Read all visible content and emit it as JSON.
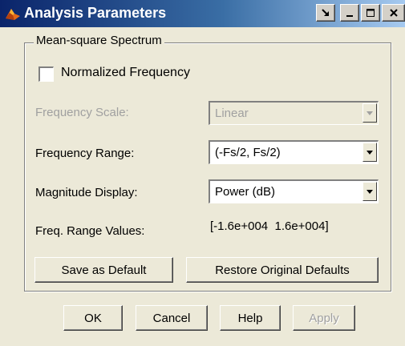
{
  "window": {
    "title": "Analysis Parameters",
    "controls": {
      "dock": "dock",
      "minimize": "minimize",
      "maximize": "maximize",
      "close": "close"
    }
  },
  "group": {
    "title": "Mean-square Spectrum",
    "normalized_frequency": {
      "label": "Normalized Frequency",
      "checked": false
    },
    "frequency_scale": {
      "label": "Frequency Scale:",
      "value": "Linear",
      "enabled": false
    },
    "frequency_range": {
      "label": "Frequency Range:",
      "value": "(-Fs/2, Fs/2)",
      "enabled": true
    },
    "magnitude_display": {
      "label": "Magnitude Display:",
      "value": "Power (dB)",
      "enabled": true
    },
    "freq_range_values": {
      "label": "Freq. Range Values:",
      "value": "[-1.6e+004  1.6e+004]"
    },
    "save_default": "Save as Default",
    "restore_defaults": "Restore Original Defaults"
  },
  "footer": {
    "ok": "OK",
    "cancel": "Cancel",
    "help": "Help",
    "apply": "Apply",
    "apply_enabled": false
  },
  "colors": {
    "title_gradient_start": "#0a246a",
    "title_gradient_end": "#a6caf0",
    "face": "#ece9d8",
    "disabled_text": "#a0a0a0"
  }
}
